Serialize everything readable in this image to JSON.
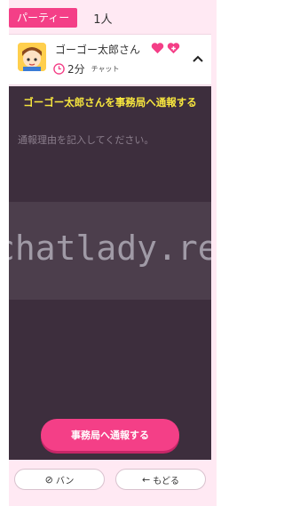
{
  "header": {
    "party_label": "パーティー",
    "member_count": "1人"
  },
  "user": {
    "name": "ゴーゴー太郎さん",
    "time": "2分",
    "type": "チャット"
  },
  "report": {
    "title": "ゴーゴー太郎さんを事務局へ通報する",
    "placeholder": "通報理由を記入してください。",
    "watermark": "chatlady.re",
    "submit_label": "事務局へ通報する"
  },
  "footer": {
    "ban_label": "バン",
    "back_label": "もどる"
  },
  "colors": {
    "accent": "#f43f87",
    "panel": "#3d2e3d",
    "title": "#f8e73e"
  }
}
